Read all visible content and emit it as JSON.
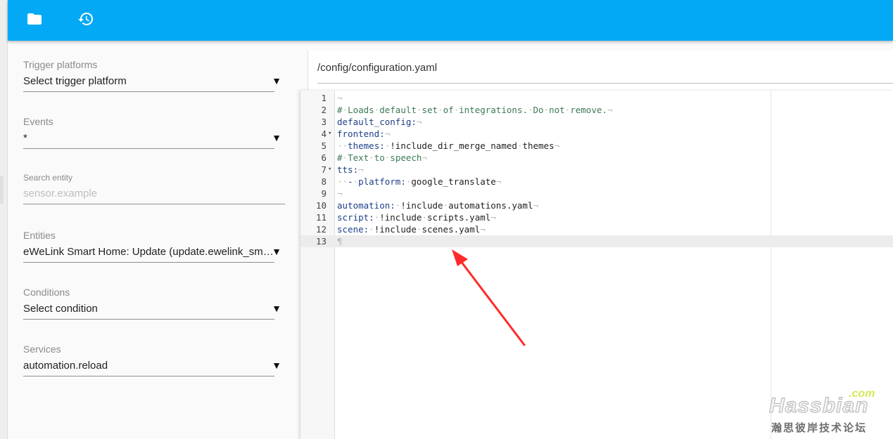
{
  "toolbar": {
    "icons": [
      {
        "name": "folder-icon"
      },
      {
        "name": "history-icon"
      }
    ]
  },
  "sidebar": {
    "trigger_platforms": {
      "label": "Trigger platforms",
      "value": "Select trigger platform"
    },
    "events": {
      "label": "Events",
      "value": "*"
    },
    "search_entity": {
      "label": "Search entity",
      "placeholder": "sensor.example"
    },
    "entities": {
      "label": "Entities",
      "value": "eWeLink Smart Home: Update (update.ewelink_smart_home)"
    },
    "conditions": {
      "label": "Conditions",
      "value": "Select condition"
    },
    "services": {
      "label": "Services",
      "value": "automation.reload"
    },
    "caret": "▼"
  },
  "editor": {
    "file_path": "/config/configuration.yaml",
    "active_line": 13,
    "whitespace_marker": "·",
    "eol_marker": "¬",
    "pilcrow": "¶",
    "lines": [
      {
        "n": "1",
        "text": ""
      },
      {
        "n": "2",
        "text": "# Loads default set of integrations. Do not remove."
      },
      {
        "n": "3",
        "text": "default_config:"
      },
      {
        "n": "4",
        "text": "frontend:",
        "fold": "▾"
      },
      {
        "n": "5",
        "text": "  themes: !include_dir_merge_named themes"
      },
      {
        "n": "6",
        "text": "# Text to speech"
      },
      {
        "n": "7",
        "text": "tts:",
        "fold": "▾"
      },
      {
        "n": "8",
        "text": "  - platform: google_translate"
      },
      {
        "n": "9",
        "text": ""
      },
      {
        "n": "10",
        "text": "automation: !include automations.yaml"
      },
      {
        "n": "11",
        "text": "script: !include scripts.yaml"
      },
      {
        "n": "12",
        "text": "scene: !include scenes.yaml"
      },
      {
        "n": "13",
        "text": ""
      }
    ]
  },
  "watermark": {
    "brand": "Hassbian",
    "tld": ".com",
    "subtitle": "瀚思彼岸技术论坛"
  },
  "colors": {
    "header": "#03a9f4",
    "arrow": "#ff2a2a",
    "comment": "#3c7a55",
    "key": "#1f3f88"
  }
}
